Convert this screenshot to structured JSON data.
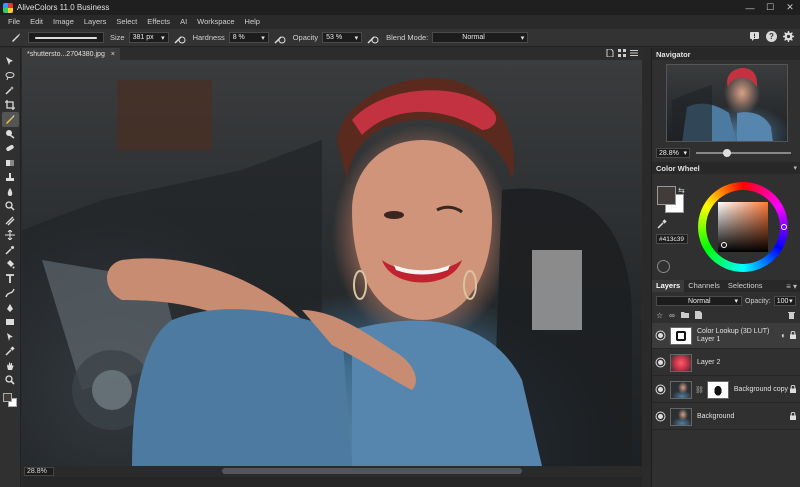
{
  "app": {
    "title": "AliveColors 11.0 Business"
  },
  "window_controls": {
    "minimize": "—",
    "maximize": "☐",
    "close": "✕"
  },
  "menu": [
    "File",
    "Edit",
    "Image",
    "Layers",
    "Select",
    "Effects",
    "AI",
    "Workspace",
    "Help"
  ],
  "options": {
    "size_label": "Size",
    "size_value": "381 px",
    "hardness_label": "Hardness",
    "hardness_value": "8 %",
    "opacity_label": "Opacity",
    "opacity_value": "53 %",
    "blend_label": "Blend Mode:",
    "blend_value": "Normal"
  },
  "document": {
    "tab_title": "*shuttersto...2704380.jpg",
    "close": "×",
    "zoom": "28.8%"
  },
  "navigator": {
    "title": "Navigator",
    "zoom": "28.8%",
    "zoom_level": 0.33
  },
  "color_wheel": {
    "title": "Color Wheel",
    "hex": "#413c39",
    "foreground": "#413c39",
    "background": "#ffffff"
  },
  "layers_panel": {
    "tabs": [
      "Layers",
      "Channels",
      "Selections"
    ],
    "active_tab": "Layers",
    "blend_mode": "Normal",
    "opacity_label": "Opacity:",
    "opacity": "100",
    "layers": [
      {
        "name_line1": "Color Lookup (3D LUT)",
        "name_line2": "Layer 1",
        "selected": true
      },
      {
        "name_line1": "Layer 2",
        "name_line2": "",
        "selected": false
      },
      {
        "name_line1": "Background copy",
        "name_line2": "",
        "selected": false
      },
      {
        "name_line1": "Background",
        "name_line2": "",
        "selected": false
      }
    ]
  },
  "colors": {
    "accent": "#413c39",
    "panel_bg": "#303030",
    "title_bg": "#1f1f1f"
  }
}
